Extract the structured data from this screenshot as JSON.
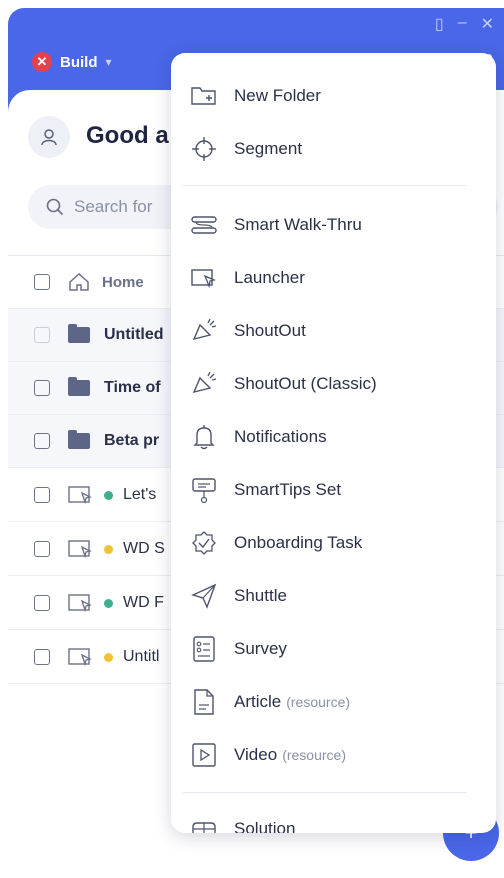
{
  "header": {
    "build_label": "Build",
    "build_icon": "close-icon",
    "window_icons": [
      "panel-icon",
      "minimize-icon",
      "close-icon"
    ]
  },
  "greeting": "Good a",
  "search": {
    "placeholder": "Search for"
  },
  "rows": [
    {
      "type": "home",
      "label": "Home"
    },
    {
      "type": "folder",
      "label": "Untitled"
    },
    {
      "type": "folder",
      "label": "Time of"
    },
    {
      "type": "folder",
      "label": "Beta pr"
    },
    {
      "type": "item",
      "label": "Let's",
      "status": "#3fae8f"
    },
    {
      "type": "item",
      "label": "WD S",
      "status": "#f0c236"
    },
    {
      "type": "item",
      "label": "WD F",
      "status": "#3fae8f"
    },
    {
      "type": "item",
      "label": "Untitl",
      "status": "#f0c236"
    }
  ],
  "menu": {
    "items": [
      {
        "label": "New Folder",
        "icon": "new-folder-icon"
      },
      {
        "label": "Segment",
        "icon": "segment-icon"
      },
      {
        "label": "Smart Walk-Thru",
        "icon": "smart-walk-thru-icon"
      },
      {
        "label": "Launcher",
        "icon": "launcher-icon"
      },
      {
        "label": "ShoutOut",
        "icon": "shoutout-icon"
      },
      {
        "label": "ShoutOut (Classic)",
        "icon": "shoutout-classic-icon"
      },
      {
        "label": "Notifications",
        "icon": "bell-icon"
      },
      {
        "label": "SmartTips Set",
        "icon": "smarttips-icon"
      },
      {
        "label": "Onboarding Task",
        "icon": "onboarding-icon"
      },
      {
        "label": "Shuttle",
        "icon": "paper-plane-icon"
      },
      {
        "label": "Survey",
        "icon": "survey-icon"
      },
      {
        "label": "Article",
        "sub": "(resource)",
        "icon": "article-icon"
      },
      {
        "label": "Video",
        "sub": "(resource)",
        "icon": "video-icon"
      },
      {
        "label": "Solution",
        "icon": "solution-icon"
      }
    ]
  },
  "colors": {
    "accent": "#4967e8",
    "danger": "#e5414c",
    "text": "#2a3047"
  }
}
